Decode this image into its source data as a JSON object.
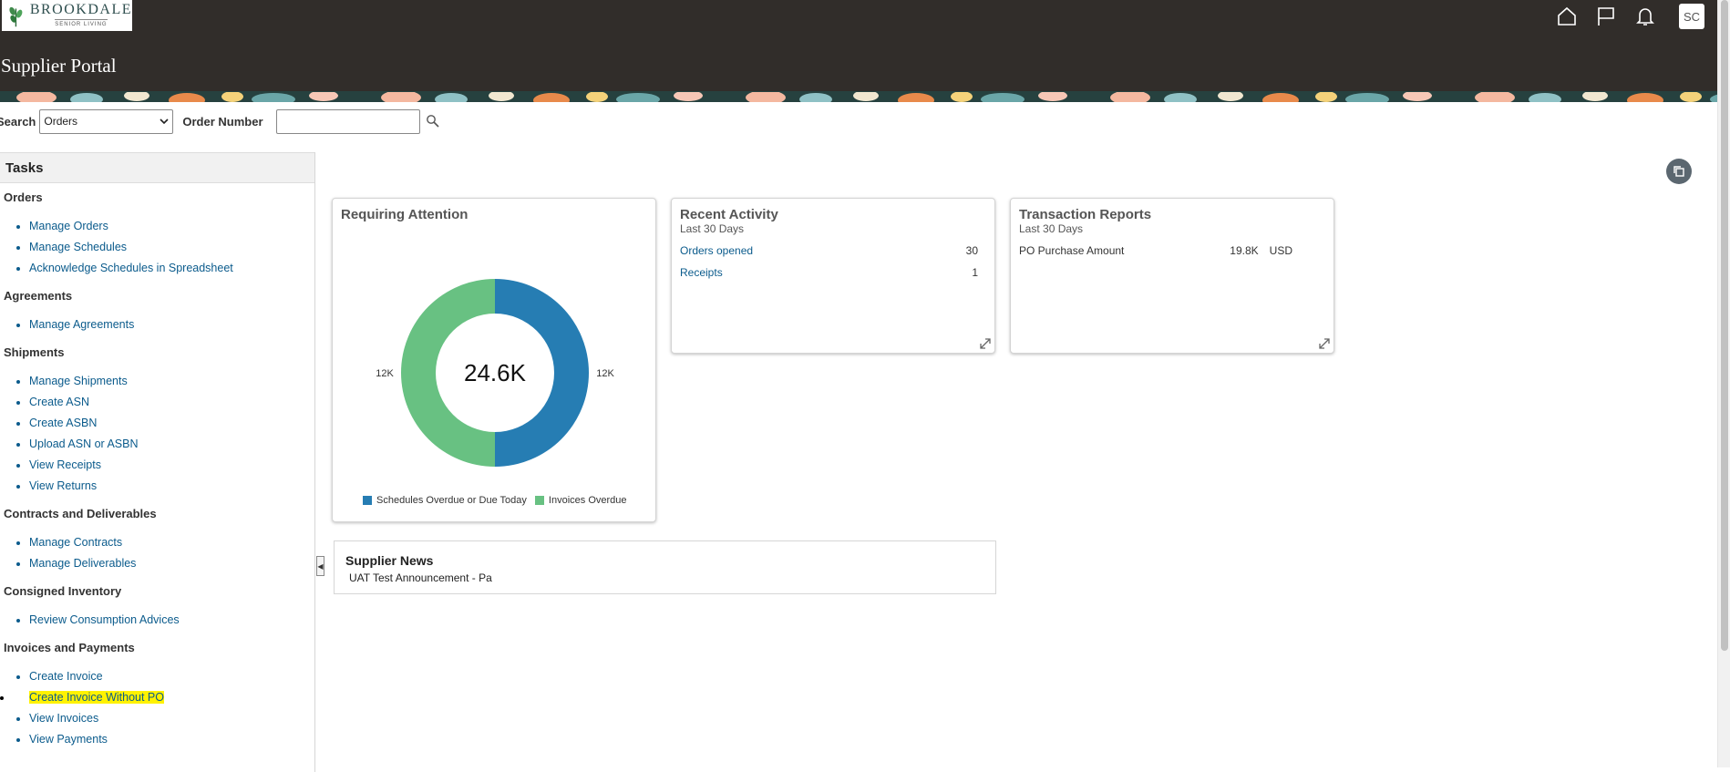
{
  "header": {
    "logo_main": "BROOKDALE",
    "logo_sub": "SENIOR LIVING",
    "title": "Supplier Portal",
    "avatar_initials": "SC"
  },
  "search": {
    "label": "Search",
    "selected": "Orders",
    "order_number_label": "Order Number",
    "order_number_value": ""
  },
  "tasks": {
    "heading": "Tasks",
    "groups": [
      {
        "title": "Orders",
        "items": [
          "Manage Orders",
          "Manage Schedules",
          "Acknowledge Schedules in Spreadsheet"
        ]
      },
      {
        "title": "Agreements",
        "items": [
          "Manage Agreements"
        ]
      },
      {
        "title": "Shipments",
        "items": [
          "Manage Shipments",
          "Create ASN",
          "Create ASBN",
          "Upload ASN or ASBN",
          "View Receipts",
          "View Returns"
        ]
      },
      {
        "title": "Contracts and Deliverables",
        "items": [
          "Manage Contracts",
          "Manage Deliverables"
        ]
      },
      {
        "title": "Consigned Inventory",
        "items": [
          "Review Consumption Advices"
        ]
      },
      {
        "title": "Invoices and Payments",
        "items": [
          "Create Invoice",
          "Create Invoice Without PO",
          "View Invoices",
          "View Payments"
        ]
      }
    ]
  },
  "requiring_attention": {
    "title": "Requiring Attention"
  },
  "chart_data": {
    "type": "pie",
    "center_label": "24.6K",
    "categories": [
      "Schedules Overdue or Due Today",
      "Invoices Overdue"
    ],
    "values": [
      12,
      12
    ],
    "value_labels": [
      "12K",
      "12K"
    ],
    "colors": [
      "#267db3",
      "#68c182"
    ],
    "donut": true
  },
  "recent_activity": {
    "title": "Recent Activity",
    "subtitle": "Last 30 Days",
    "rows": [
      {
        "name": "Orders opened",
        "value": "30"
      },
      {
        "name": "Receipts",
        "value": "1"
      }
    ]
  },
  "transaction_reports": {
    "title": "Transaction Reports",
    "subtitle": "Last 30 Days",
    "rows": [
      {
        "name": "PO Purchase Amount",
        "value": "19.8K",
        "currency": "USD"
      }
    ]
  },
  "news": {
    "title": "Supplier News",
    "item": "UAT Test Announcement - Pa"
  },
  "colors": {
    "header_bg": "#312d2a",
    "link": "#0b5b8c",
    "highlight": "#fff200"
  }
}
